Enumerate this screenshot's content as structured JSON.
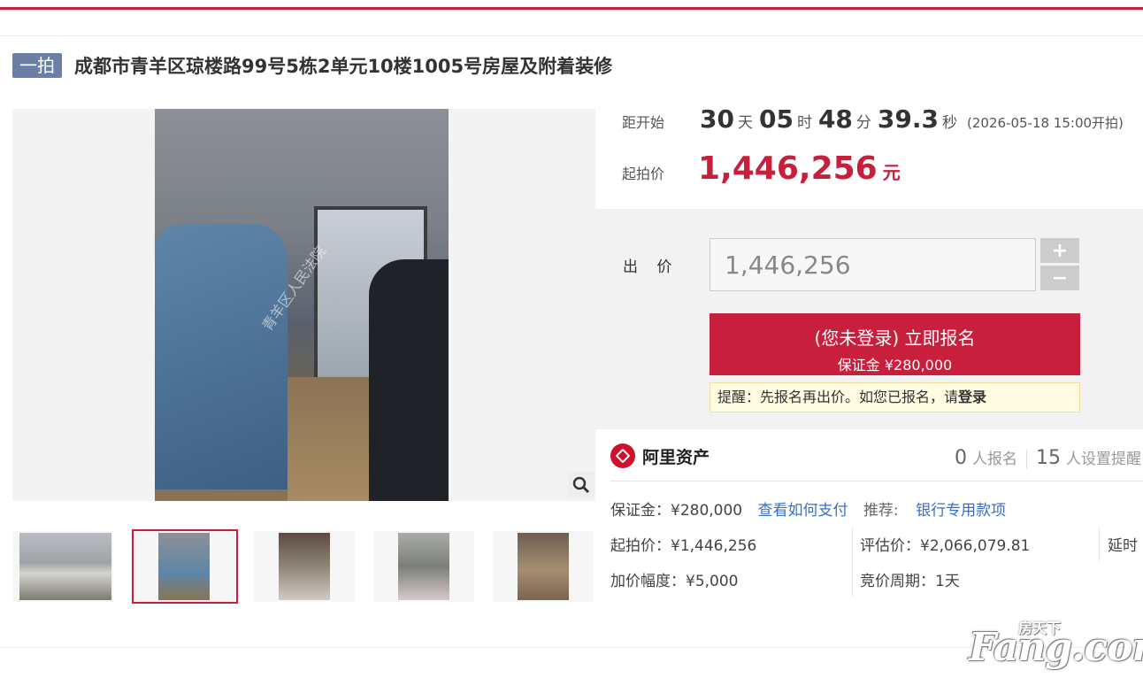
{
  "header": {
    "round_badge": "一拍",
    "title": "成都市青羊区琼楼路99号5栋2单元10楼1005号房屋及附着装修"
  },
  "countdown": {
    "label": "距开始",
    "days": "30",
    "days_unit": "天",
    "hours": "05",
    "hours_unit": "时",
    "minutes": "48",
    "minutes_unit": "分",
    "seconds": "39.3",
    "seconds_unit": "秒",
    "start_time": "(2026-05-18 15:00开拍)"
  },
  "starting_price": {
    "label": "起拍价",
    "value": "1,446,256",
    "unit": "元"
  },
  "bid": {
    "label": "出 价",
    "value": "1,446,256",
    "plus": "+",
    "minus": "−",
    "signup_line1": "(您未登录) 立即报名",
    "signup_line2": "保证金 ¥280,000",
    "tip_text": "提醒：先报名再出价。如您已报名，请",
    "tip_link": "登录"
  },
  "platform": {
    "name": "阿里资产",
    "signups_count": "0",
    "signups_label": "人报名",
    "reminders_count": "15",
    "reminders_label": "人设置提醒"
  },
  "details": {
    "deposit": "保证金：¥280,000",
    "how_to_pay": "查看如何支付",
    "recommend_label": "推荐:",
    "recommend_link": "银行专用款项",
    "start_price": "起拍价：¥1,446,256",
    "appraisal": "评估价：¥2,066,079.81",
    "delay": "延时",
    "increment": "加价幅度：¥5,000",
    "cycle": "竞价周期：1天"
  },
  "gallery": {
    "photo_watermark": "青羊区人民法院",
    "zoom_icon": "magnifier-icon"
  },
  "watermark": {
    "main": "Fang.com",
    "sub": "房天下"
  },
  "colors": {
    "brand_red": "#c8203c",
    "link_blue": "#3a6fc4",
    "badge_blue": "#6b7fa6"
  }
}
